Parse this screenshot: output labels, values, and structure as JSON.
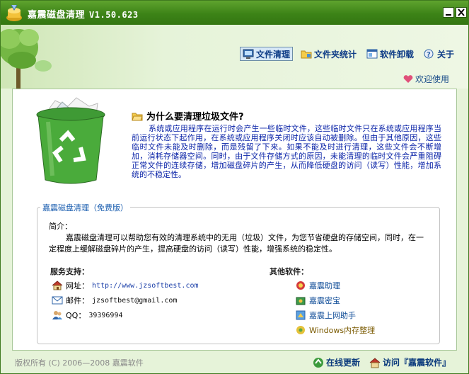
{
  "window": {
    "title": "嘉震磁盘清理",
    "version": "V1.50.623",
    "min_label": "_",
    "close_label": "×"
  },
  "toolbar": {
    "items": [
      {
        "label": "文件清理",
        "icon": "monitor-icon",
        "active": true
      },
      {
        "label": "文件夹统计",
        "icon": "folder-icon",
        "active": false
      },
      {
        "label": "软件卸载",
        "icon": "window-icon",
        "active": false
      },
      {
        "label": "关于",
        "icon": "help-icon",
        "active": false
      }
    ]
  },
  "welcome": {
    "label": "欢迎使用",
    "icon": "heart-icon"
  },
  "why": {
    "title": "为什么要清理垃圾文件?",
    "text": "系统或应用程序在运行时会产生一些临时文件，这些临时文件只在系统或应用程序当前运行状态下起作用，在系统或应用程序关闭时应该自动被删除。但由于其他原因，这些临时文件未能及时删除，而是残留了下来。如果不能及时进行清理，这些文件会不断增加，消耗存储器空间。同时，由于文件存储方式的原因，未能清理的临时文件会严重阻碍正常文件的连续存储，增加磁盘碎片的产生，从而降低硬盘的访问（读写）性能，增加系统的不稳定性。"
  },
  "group": {
    "legend": "嘉震磁盘清理（免费版）",
    "intro_label": "简介：",
    "intro_text": "嘉震磁盘清理可以帮助您有效的清理系统中的无用（垃圾）文件，为您节省硬盘的存储空间，同时，在一定程度上缓解磁盘碎片的产生，提高硬盘的访问（读写）性能，增强系统的稳定性。",
    "service_label": "服务支持：",
    "website_label": "网址：",
    "website": "http://www.jzsoftbest.com",
    "email_label": "邮件：",
    "email": "jzsoftbest@gmail.com",
    "qq_label": "QQ：",
    "qq": "39396994",
    "other_label": "其他软件：",
    "software": [
      "嘉震助理",
      "嘉震密宝",
      "嘉震上网助手",
      "Windows内存整理"
    ]
  },
  "footer": {
    "copyright": "版权所有 (C) 2006—2008 嘉震软件",
    "update_label": "在线更新",
    "visit_label": "访问『嘉震软件』"
  },
  "colors": {
    "titlebar": "#3c8317",
    "link": "#0d3b86",
    "body_text": "#0b24a8"
  }
}
